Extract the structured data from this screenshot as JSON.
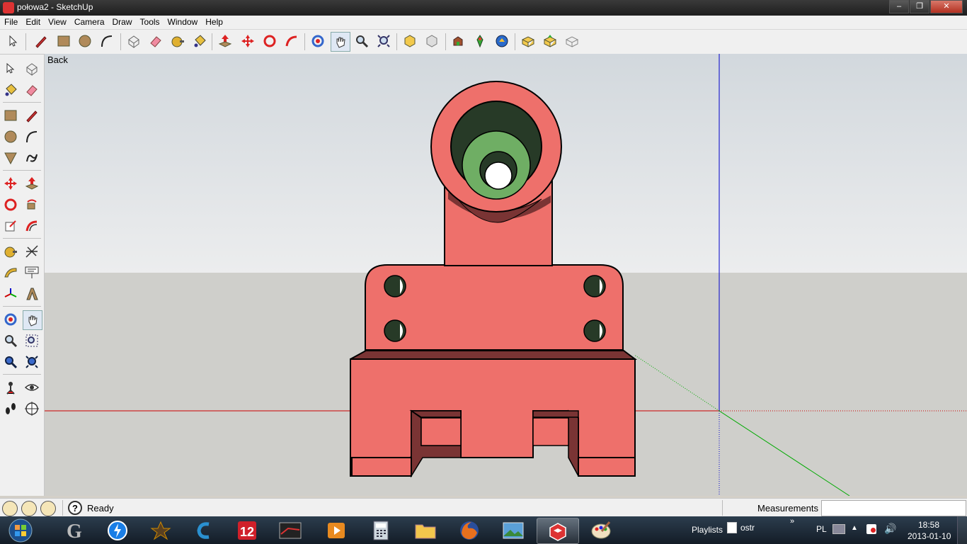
{
  "window": {
    "title": "połowa2 - SketchUp",
    "minimize_glyph": "–",
    "maximize_glyph": "❐",
    "close_glyph": "✕"
  },
  "menu": [
    "File",
    "Edit",
    "View",
    "Camera",
    "Draw",
    "Tools",
    "Window",
    "Help"
  ],
  "viewport": {
    "scene_label": "Back",
    "colors": {
      "sky": "#dfe3e6",
      "ground": "#cfcfcb",
      "model_face": "#ee706b",
      "model_shadow": "#7a3434",
      "hole_dark": "#273a27",
      "hole_green": "#6fae64",
      "x_axis": "#cc0000",
      "y_axis": "#00aa00",
      "z_axis": "#0000cc"
    }
  },
  "status": {
    "text": "Ready",
    "measurements_label": "Measurements",
    "measurements_value": ""
  },
  "taskbar": {
    "apps": [
      "windows-start",
      "game-g",
      "blitz",
      "witcher",
      "cloud-app",
      "flash-12",
      "racing-game",
      "media-player",
      "calculator",
      "file-explorer",
      "firefox",
      "image-viewer",
      "sketchup",
      "paint-app"
    ],
    "playlists_label": "Playlists",
    "playlist_item": "ostr",
    "lang": "PL",
    "time": "18:58",
    "date": "2013-01-10"
  }
}
